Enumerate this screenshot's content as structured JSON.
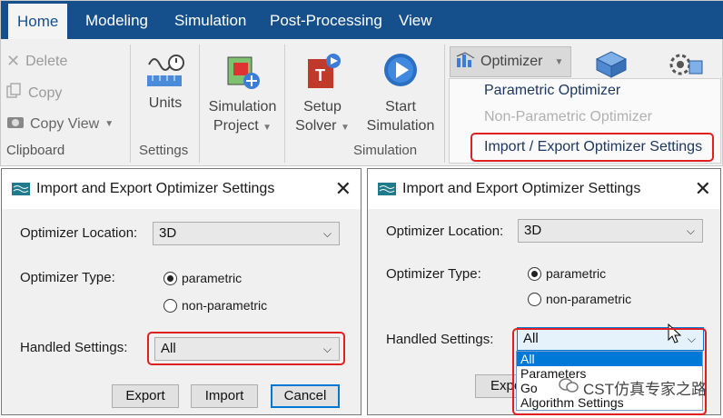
{
  "ribbon": {
    "tabs": [
      "Home",
      "Modeling",
      "Simulation",
      "Post-Processing",
      "View"
    ],
    "clipboard": {
      "delete_label": "Delete",
      "copy_label": "Copy",
      "copy_view_label": "Copy View",
      "group_label": "Clipboard"
    },
    "settings": {
      "units_label": "Units",
      "group_label": "Settings"
    },
    "simulation": {
      "sim_project_label_1": "Simulation",
      "sim_project_label_2": "Project",
      "setup_solver_label_1": "Setup",
      "setup_solver_label_2": "Solver",
      "start_sim_label_1": "Start",
      "start_sim_label_2": "Simulation",
      "group_label": "Simulation"
    },
    "optimizer": {
      "label": "Optimizer",
      "menu": [
        "Parametric Optimizer",
        "Non-Parametric Optimizer",
        "Import / Export Optimizer Settings"
      ]
    }
  },
  "dialog_left": {
    "title": "Import and Export Optimizer Settings",
    "location_label": "Optimizer Location:",
    "location_value": "3D",
    "type_label": "Optimizer Type:",
    "type_options": [
      "parametric",
      "non-parametric"
    ],
    "type_selected": "parametric",
    "handled_label": "Handled Settings:",
    "handled_value": "All",
    "buttons": {
      "export": "Export",
      "import": "Import",
      "cancel": "Cancel"
    }
  },
  "dialog_right": {
    "title": "Import and Export Optimizer Settings",
    "location_label": "Optimizer Location:",
    "location_value": "3D",
    "type_label": "Optimizer Type:",
    "type_options": [
      "parametric",
      "non-parametric"
    ],
    "handled_label": "Handled Settings:",
    "handled_value": "All",
    "handled_options": [
      "All",
      "Parameters",
      "Goals",
      "Algorithm Settings"
    ],
    "export_partial": "Expo",
    "goals_partial": "Go"
  },
  "watermark": "CST仿真专家之路",
  "colors": {
    "accent": "#16508c",
    "highlight": "#e02020",
    "selection": "#0078d7"
  }
}
